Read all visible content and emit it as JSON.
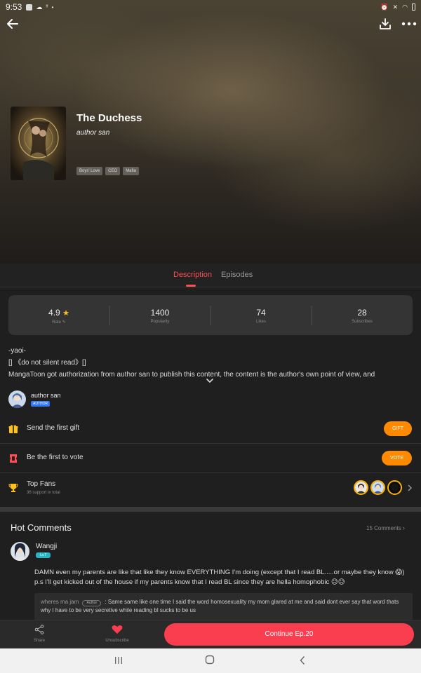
{
  "status_bar": {
    "time": "9:53"
  },
  "comic": {
    "title": "The Duchess",
    "author": "author san",
    "tags": [
      "Boys' Love",
      "CEO",
      "Mafia"
    ]
  },
  "tabs": [
    {
      "label": "Description"
    },
    {
      "label": "Episodes"
    }
  ],
  "stats": [
    {
      "value": "4.9",
      "label": "Rate"
    },
    {
      "value": "1400",
      "label": "Popularity"
    },
    {
      "value": "74",
      "label": "Likes"
    },
    {
      "value": "28",
      "label": "Subscribes"
    }
  ],
  "description": {
    "line1": "-yaoi-",
    "line2": "[]  《do not silent read》[]",
    "line3": "MangaToon got authorization from author san to publish this content, the content is the author's own point of view, and"
  },
  "author": {
    "name": "author san",
    "badge": "AUTHOR"
  },
  "gift_row": {
    "label": "Send the first gift",
    "button": "GIFT"
  },
  "vote_row": {
    "label": "Be the first to vote",
    "button": "VOTE"
  },
  "fans_row": {
    "label": "Top Fans",
    "sub": "36 support in total"
  },
  "hot_comments": {
    "title": "Hot Comments",
    "count": "15 Comments",
    "comment": {
      "user": "Wangji",
      "level": "Lv.7",
      "text": "DAMN even my parents are like that like they know EVERYTHING I'm doing (except that I read BL.....or maybe they know 😱) p.s I'll get kicked out of the house if my parents know that I read BL since they are hella homophobic 😥😥",
      "reply_user": "wheres ma jam",
      "reply_badge": "Author",
      "reply_text": ": Same same like one time I said the word homosexuality my mom glared at me and said dont ever say that word thats why I have to be very secretive while reading bl sucks to be us"
    }
  },
  "actions": {
    "share": "Share",
    "unsubscribe": "Unsubscribe",
    "continue": "Continue Ep.20"
  },
  "colors": {
    "accent": "#fb3e4f",
    "pill": "#ff8a00",
    "star": "#ffc21a",
    "level_badge": "#2bb3c4",
    "author_badge": "#3478f6"
  }
}
